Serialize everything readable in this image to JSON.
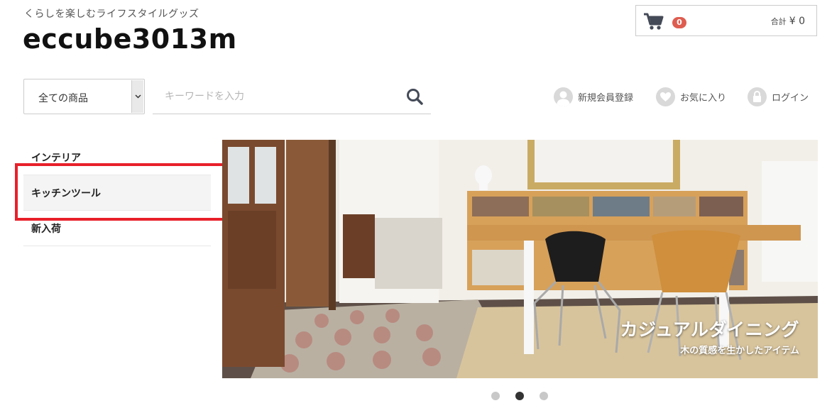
{
  "header": {
    "tagline": "くらしを楽しむライフスタイルグッズ",
    "site_title": "eccube3013m"
  },
  "cart": {
    "count": "0",
    "total_label": "合計",
    "total_value": "¥ 0"
  },
  "search": {
    "category_selected": "全ての商品",
    "placeholder": "キーワードを入力"
  },
  "nav": {
    "register": "新規会員登録",
    "favorites": "お気に入り",
    "login": "ログイン"
  },
  "sidebar": {
    "items": [
      {
        "label": "インテリア"
      },
      {
        "label": "キッチンツール"
      },
      {
        "label": "新入荷"
      }
    ]
  },
  "hero": {
    "title": "カジュアルダイニング",
    "subtitle": "木の質感を生かしたアイテム"
  },
  "slider": {
    "active_index": 1,
    "count": 3
  },
  "colors": {
    "badge": "#de5d50",
    "highlight": "#e8202a"
  }
}
